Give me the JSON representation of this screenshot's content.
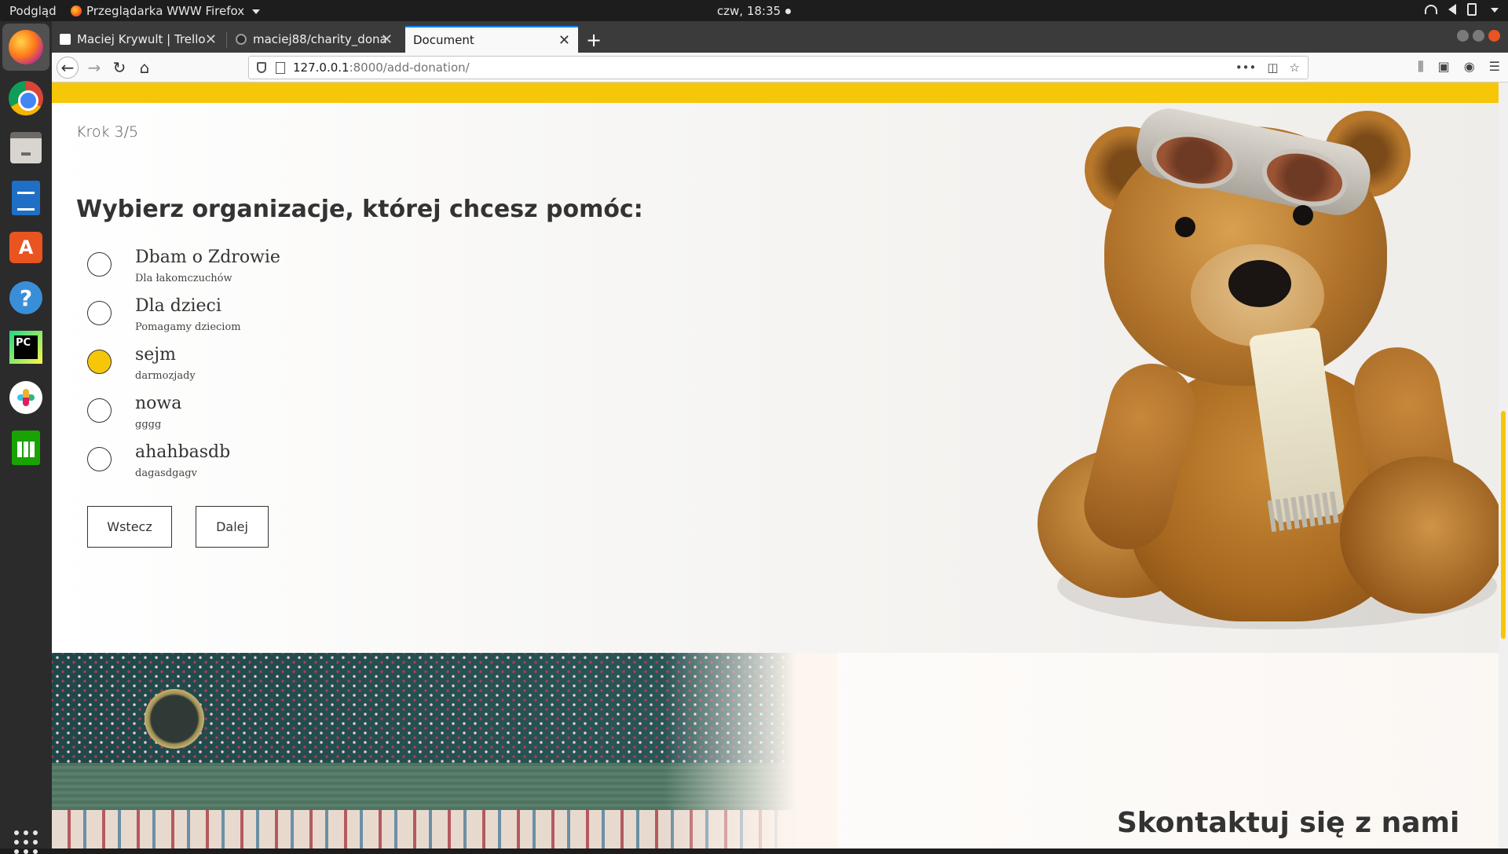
{
  "topbar": {
    "activities": "Podgląd",
    "app_name": "Przeglądarka WWW Firefox",
    "clock": "czw, 18:35"
  },
  "dock": {
    "items": [
      "firefox-icon",
      "chrome-icon",
      "files-icon",
      "writer-icon",
      "software-center-icon",
      "help-icon",
      "pycharm-icon",
      "slack-icon",
      "calc-icon",
      "app-grid-icon"
    ]
  },
  "browser": {
    "tabs": [
      {
        "label": "Maciej Krywult | Trello",
        "icon": "trello-icon",
        "active": false
      },
      {
        "label": "maciej88/charity_donati",
        "icon": "github-icon",
        "active": false
      },
      {
        "label": "Document",
        "icon": "",
        "active": true
      }
    ],
    "url_host": "127.0.0.1",
    "url_path": ":8000/add-donation/",
    "url_actions": "•••"
  },
  "form": {
    "step": "Krok 3/5",
    "title": "Wybierz organizacje, której chcesz pomóc:",
    "organizations": [
      {
        "name": "Dbam o Zdrowie",
        "description": "Dla łakomczuchów",
        "checked": false
      },
      {
        "name": "Dla dzieci",
        "description": "Pomagamy dzieciom",
        "checked": false
      },
      {
        "name": "sejm",
        "description": "darmozjady",
        "checked": true
      },
      {
        "name": "nowa",
        "description": "gggg",
        "checked": false
      },
      {
        "name": "ahahbasdb",
        "description": "dagasdgagv",
        "checked": false
      }
    ],
    "back_label": "Wstecz",
    "next_label": "Dalej"
  },
  "contact": {
    "title": "Skontaktuj się z nami"
  },
  "colors": {
    "accent": "#f6c709",
    "text": "#333333"
  }
}
